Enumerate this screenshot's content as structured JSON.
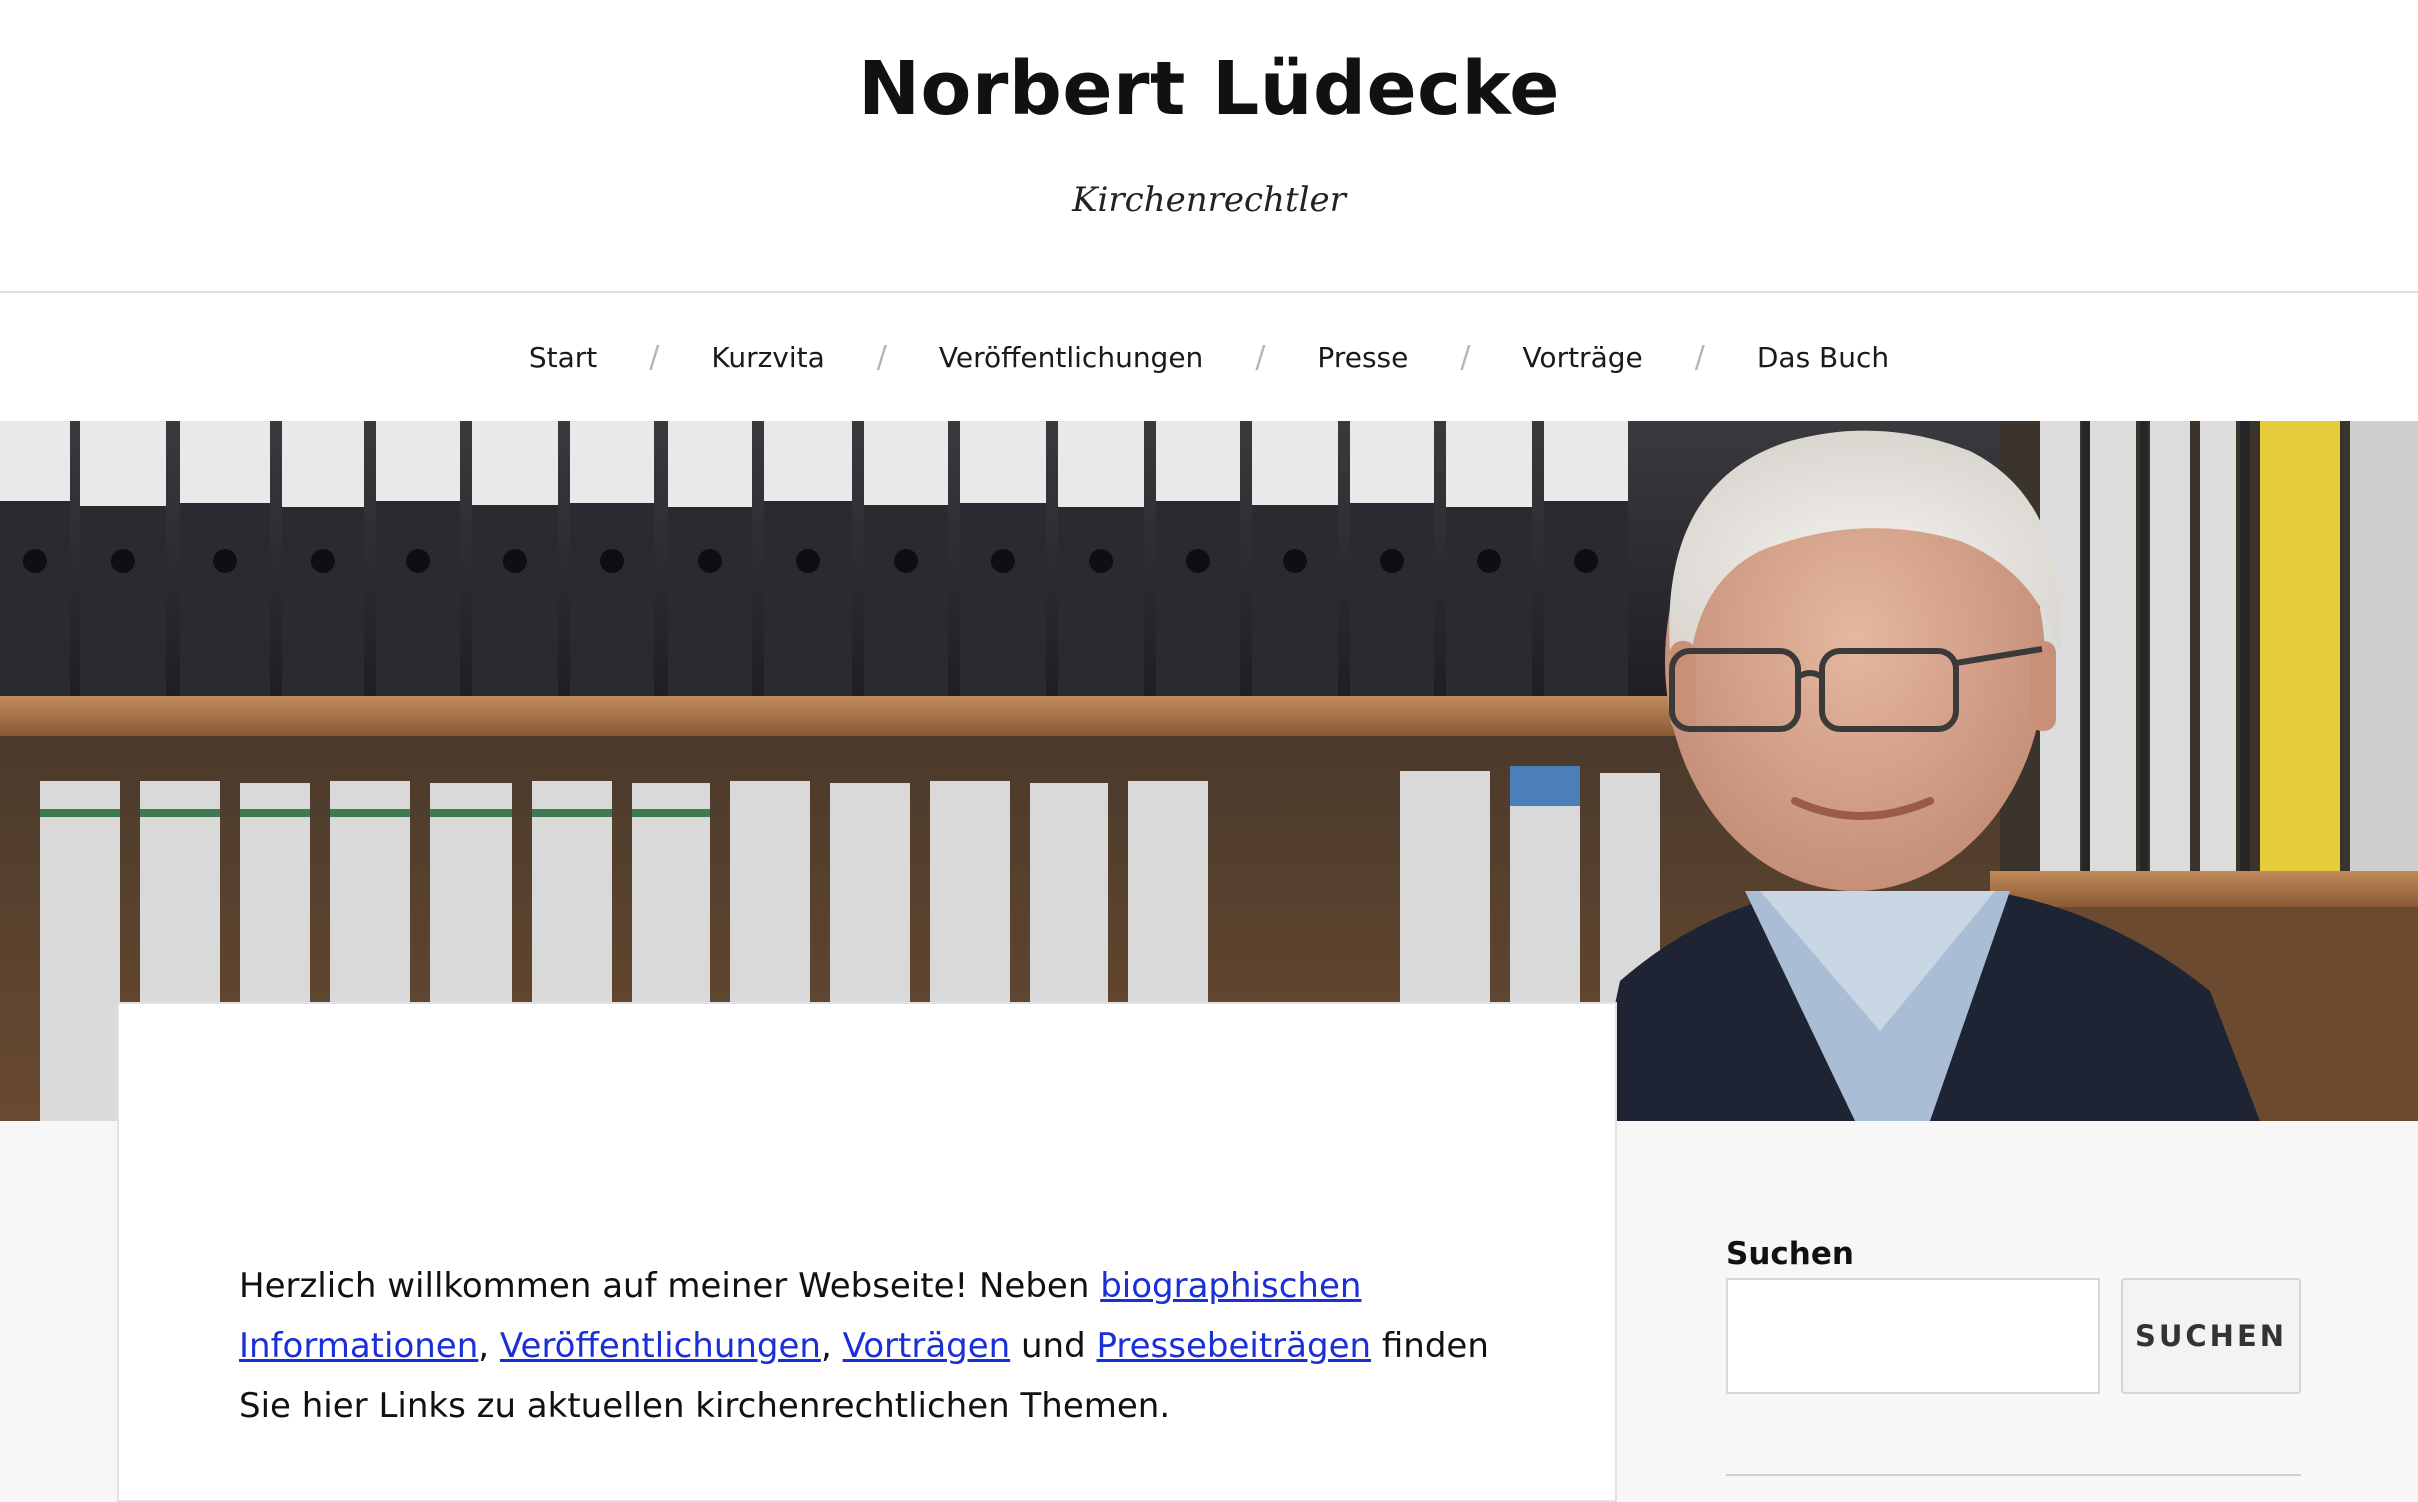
{
  "header": {
    "title": "Norbert Lüdecke",
    "tagline": "Kirchenrechtler"
  },
  "nav": {
    "items": [
      {
        "label": "Start"
      },
      {
        "label": "Kurzvita"
      },
      {
        "label": "Veröffentlichungen"
      },
      {
        "label": "Presse"
      },
      {
        "label": "Vorträge"
      },
      {
        "label": "Das Buch"
      }
    ],
    "separator": "/"
  },
  "intro": {
    "text_1": "Herzlich willkommen auf meiner Webseite! Neben ",
    "link_bio": "biographischen Informationen",
    "sep_1": ", ",
    "link_pubs": "Veröffentlichungen",
    "sep_2": ", ",
    "link_talks": "Vorträgen",
    "text_2": " und ",
    "link_press": "Pressebeiträgen",
    "text_3": " finden Sie hier Links zu aktuellen kirchenrechtlichen Themen."
  },
  "sidebar": {
    "search_label": "Suchen",
    "search_placeholder": "",
    "search_button": "SUCHEN"
  },
  "colors": {
    "link": "#1b2fd6",
    "background": "#f7f7f7",
    "card": "#ffffff"
  }
}
